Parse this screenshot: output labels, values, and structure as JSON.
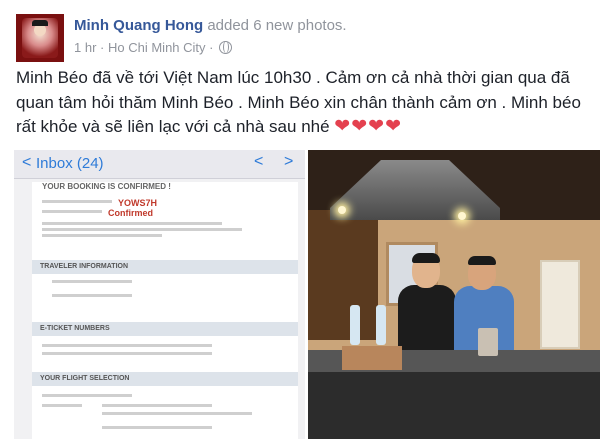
{
  "post": {
    "author": "Minh Quang Hong",
    "action": "added 6 new photos.",
    "time": "1 hr",
    "separator1": "·",
    "location": "Ho Chi Minh City",
    "separator2": "·",
    "privacy_icon": "globe-icon",
    "message": "Minh Béo đã về tới Việt Nam lúc 10h30 . Cảm ơn cả nhà thời gian qua đã quan tâm hỏi thăm Minh Béo . Minh Béo xin chân thành cảm ơn . Minh béo rất khỏe và sẽ liên lạc với cả nhà sau nhé",
    "hearts": [
      "❤",
      "❤",
      "❤",
      "❤"
    ]
  },
  "photo_left": {
    "inbox_label": "Inbox (24)",
    "back_glyph": "<",
    "up_glyph": "<",
    "down_glyph": ">",
    "confirm_title": "YOUR BOOKING IS CONFIRMED !",
    "reservation_code": "YOWS7H",
    "booking_status": "Confirmed",
    "section_traveler": "TRAVELER INFORMATION",
    "section_eticket": "E-TICKET NUMBERS",
    "section_flight": "YOUR FLIGHT SELECTION"
  },
  "colors": {
    "link_blue": "#365899",
    "meta_gray": "#90949c",
    "heart_red": "#e4414f",
    "ios_blue": "#2e7bd8"
  }
}
